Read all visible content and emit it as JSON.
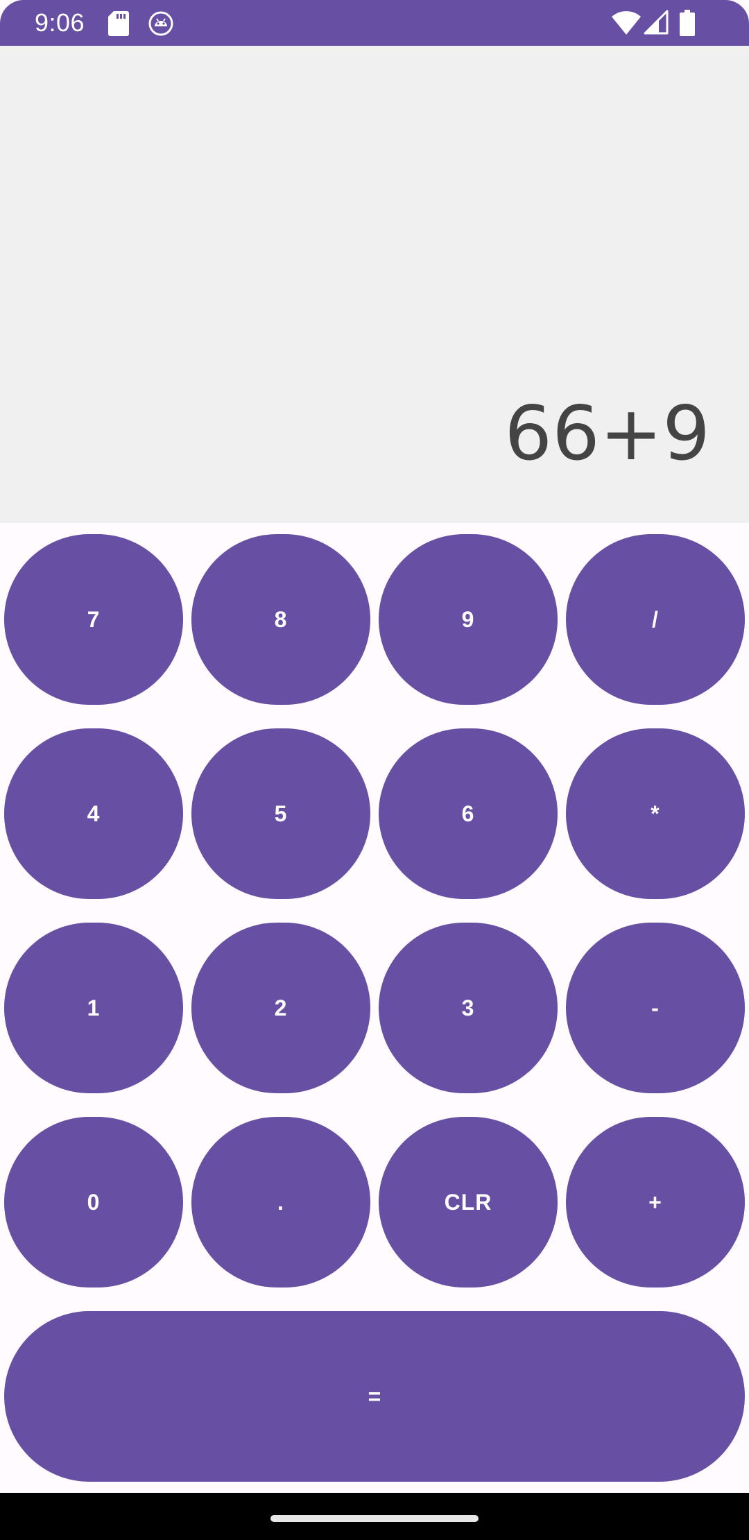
{
  "status_bar": {
    "time": "9:06",
    "icons": [
      "sd-card-icon",
      "android-debug-icon",
      "wifi-icon",
      "cell-signal-icon",
      "battery-icon"
    ],
    "background_color": "#6750a4"
  },
  "display": {
    "expression": "66+9",
    "background_color": "#f0f0f0",
    "text_color": "#444444"
  },
  "keypad": {
    "accent_color": "#6750a4",
    "rows": [
      [
        {
          "label": "7",
          "name": "key-7-button"
        },
        {
          "label": "8",
          "name": "key-8-button"
        },
        {
          "label": "9",
          "name": "key-9-button"
        },
        {
          "label": "/",
          "name": "divide-button"
        }
      ],
      [
        {
          "label": "4",
          "name": "key-4-button"
        },
        {
          "label": "5",
          "name": "key-5-button"
        },
        {
          "label": "6",
          "name": "key-6-button"
        },
        {
          "label": "*",
          "name": "multiply-button"
        }
      ],
      [
        {
          "label": "1",
          "name": "key-1-button"
        },
        {
          "label": "2",
          "name": "key-2-button"
        },
        {
          "label": "3",
          "name": "key-3-button"
        },
        {
          "label": "-",
          "name": "subtract-button"
        }
      ],
      [
        {
          "label": "0",
          "name": "key-0-button"
        },
        {
          "label": ".",
          "name": "decimal-point-button"
        },
        {
          "label": "CLR",
          "name": "clear-button"
        },
        {
          "label": "+",
          "name": "add-button"
        }
      ]
    ],
    "equals_label": "="
  }
}
